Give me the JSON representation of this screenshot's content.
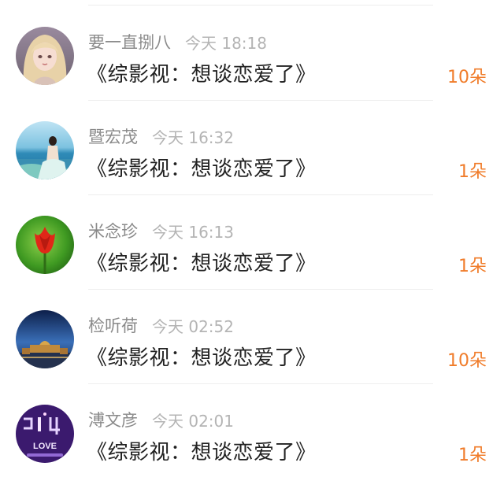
{
  "rows": [
    {
      "username": "要一直捌八",
      "time": "今天 18:18",
      "content": "《综影视：想谈恋爱了》",
      "flowers": "10朵"
    },
    {
      "username": "暨宏茂",
      "time": "今天 16:32",
      "content": "《综影视：想谈恋爱了》",
      "flowers": "1朵"
    },
    {
      "username": "米念珍",
      "time": "今天 16:13",
      "content": "《综影视：想谈恋爱了》",
      "flowers": "1朵"
    },
    {
      "username": "检听荷",
      "time": "今天 02:52",
      "content": "《综影视：想谈恋爱了》",
      "flowers": "10朵"
    },
    {
      "username": "溥文彦",
      "time": "今天 02:01",
      "content": "《综影视：想谈恋爱了》",
      "flowers": "1朵"
    }
  ],
  "colors": {
    "flower_count": "#f07c2a",
    "username": "#8a8a8a",
    "time": "#b4b4b4",
    "content": "#222222"
  },
  "avatar_images": [
    "anime-girl-portrait",
    "woman-on-beach",
    "red-tulip",
    "palace-at-dusk",
    "neon-love-sign"
  ],
  "avatar_text": {
    "neon_love": "LOVE"
  }
}
